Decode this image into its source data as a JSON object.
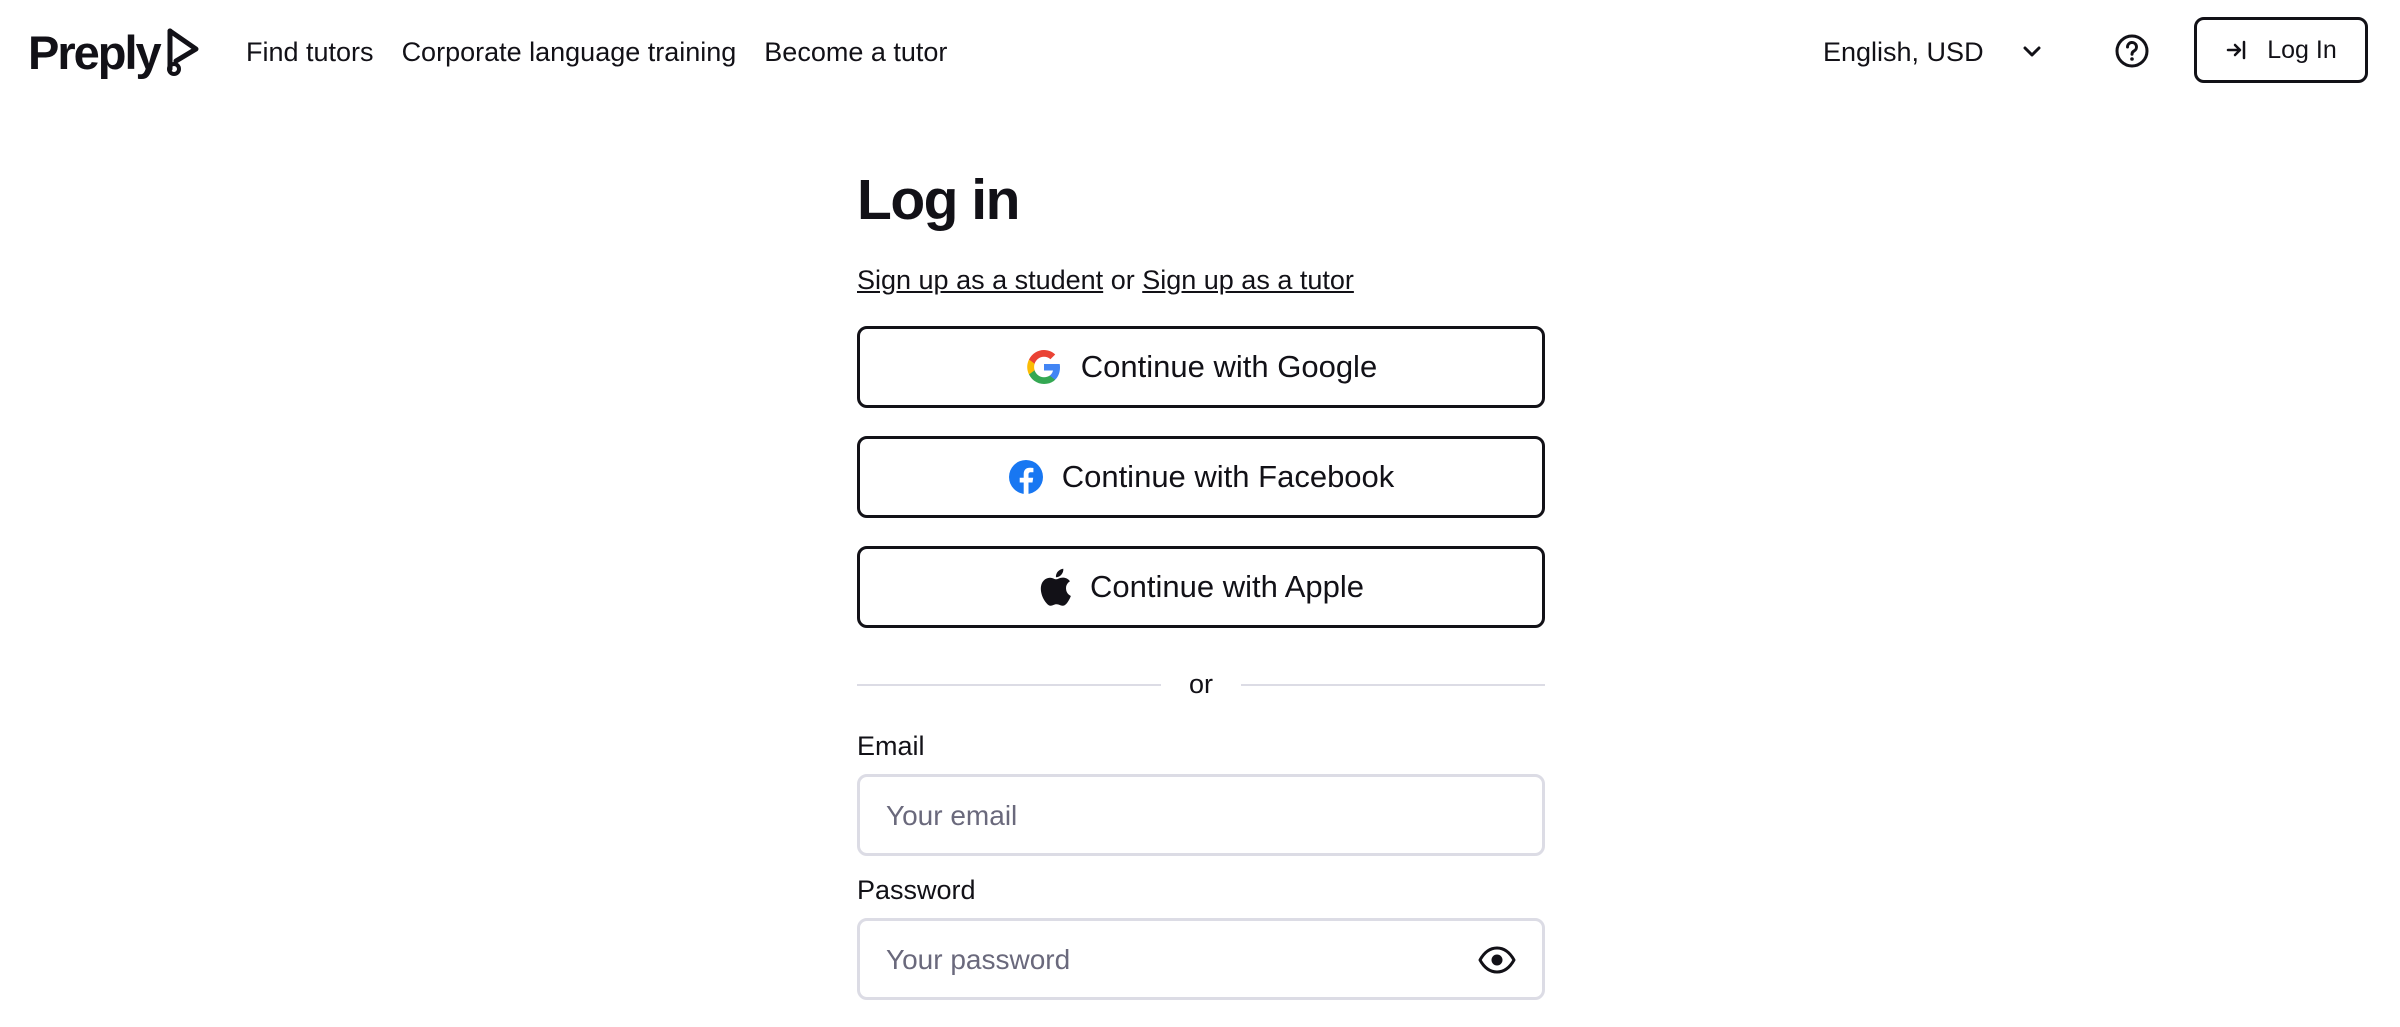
{
  "header": {
    "logo_text": "Preply",
    "nav": [
      "Find tutors",
      "Corporate language training",
      "Become a tutor"
    ],
    "language_currency": "English, USD",
    "login_label": "Log In"
  },
  "main": {
    "title": "Log in",
    "signup_student": "Sign up as a student",
    "signup_or": "or",
    "signup_tutor": "Sign up as a tutor",
    "social": {
      "google": "Continue with Google",
      "facebook": "Continue with Facebook",
      "apple": "Continue with Apple"
    },
    "divider": "or",
    "email_label": "Email",
    "email_placeholder": "Your email",
    "password_label": "Password",
    "password_placeholder": "Your password"
  },
  "colors": {
    "text": "#121117",
    "border_input": "#dcdce5",
    "placeholder": "#6a697c",
    "facebook": "#1877f2"
  },
  "icons": [
    "preply-logo-mark",
    "chevron-down-icon",
    "help-icon",
    "login-arrow-icon",
    "google-icon",
    "facebook-icon",
    "apple-icon",
    "eye-icon"
  ]
}
